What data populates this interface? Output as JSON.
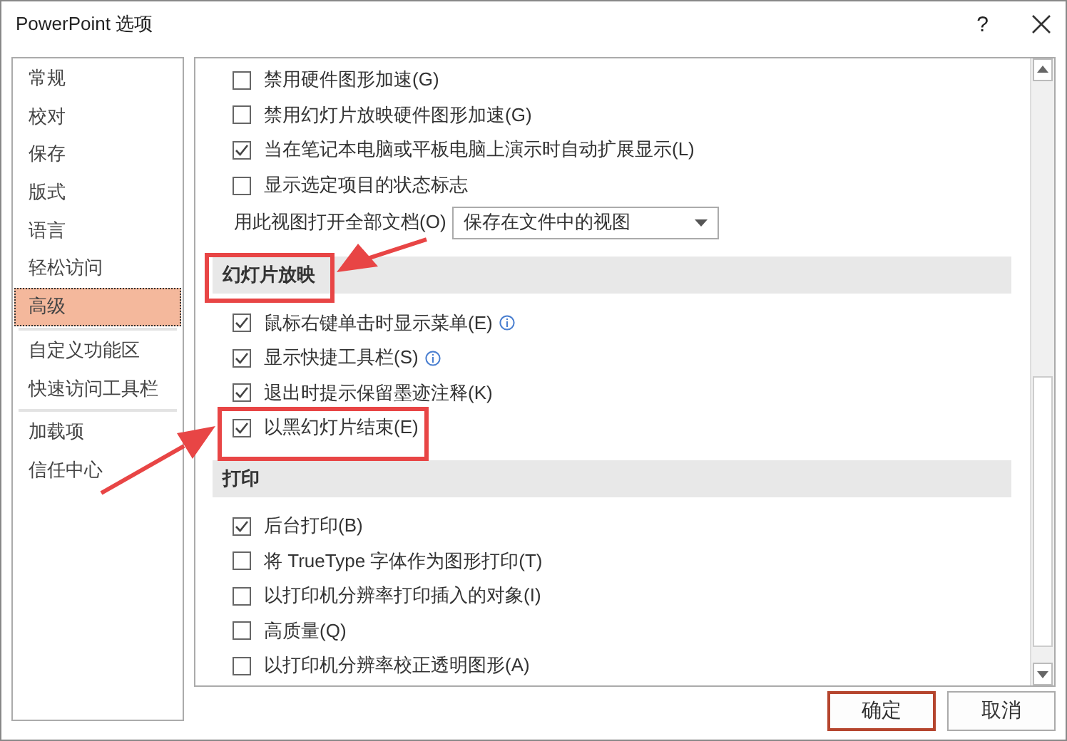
{
  "window": {
    "title": "PowerPoint 选项",
    "help": "?"
  },
  "sidebar": {
    "groups": [
      [
        {
          "label": "常规",
          "selected": false
        },
        {
          "label": "校对",
          "selected": false
        },
        {
          "label": "保存",
          "selected": false
        },
        {
          "label": "版式",
          "selected": false
        },
        {
          "label": "语言",
          "selected": false
        },
        {
          "label": "轻松访问",
          "selected": false
        },
        {
          "label": "高级",
          "selected": true
        }
      ],
      [
        {
          "label": "自定义功能区",
          "selected": false
        },
        {
          "label": "快速访问工具栏",
          "selected": false
        }
      ],
      [
        {
          "label": "加载项",
          "selected": false
        },
        {
          "label": "信任中心",
          "selected": false
        }
      ]
    ]
  },
  "options": [
    {
      "kind": "checkbox",
      "label": "禁用硬件图形加速(G)",
      "checked": false
    },
    {
      "kind": "checkbox",
      "label": "禁用幻灯片放映硬件图形加速(G)",
      "checked": false
    },
    {
      "kind": "checkbox",
      "label": "当在笔记本电脑或平板电脑上演示时自动扩展显示(L)",
      "checked": true
    },
    {
      "kind": "checkbox",
      "label": "显示选定项目的状态标志",
      "checked": false
    },
    {
      "kind": "dropdown",
      "label": "用此视图打开全部文档(O)",
      "value": "保存在文件中的视图"
    },
    {
      "kind": "section",
      "label": "幻灯片放映"
    },
    {
      "kind": "checkbox",
      "label": "鼠标右键单击时显示菜单(E)",
      "checked": true,
      "info": true
    },
    {
      "kind": "checkbox",
      "label": "显示快捷工具栏(S)",
      "checked": true,
      "info": true
    },
    {
      "kind": "checkbox",
      "label": "退出时提示保留墨迹注释(K)",
      "checked": true
    },
    {
      "kind": "checkbox",
      "label": "以黑幻灯片结束(E)",
      "checked": true
    },
    {
      "kind": "section",
      "label": "打印"
    },
    {
      "kind": "checkbox",
      "label": "后台打印(B)",
      "checked": true
    },
    {
      "kind": "checkbox",
      "label": "将 TrueType 字体作为图形打印(T)",
      "checked": false
    },
    {
      "kind": "checkbox",
      "label": "以打印机分辨率打印插入的对象(I)",
      "checked": false
    },
    {
      "kind": "checkbox",
      "label": "高质量(Q)",
      "checked": false
    },
    {
      "kind": "checkbox",
      "label": "以打印机分辨率校正透明图形(A)",
      "checked": false
    }
  ],
  "buttons": [
    {
      "label": "确定",
      "default": true
    },
    {
      "label": "取消",
      "default": false
    }
  ]
}
